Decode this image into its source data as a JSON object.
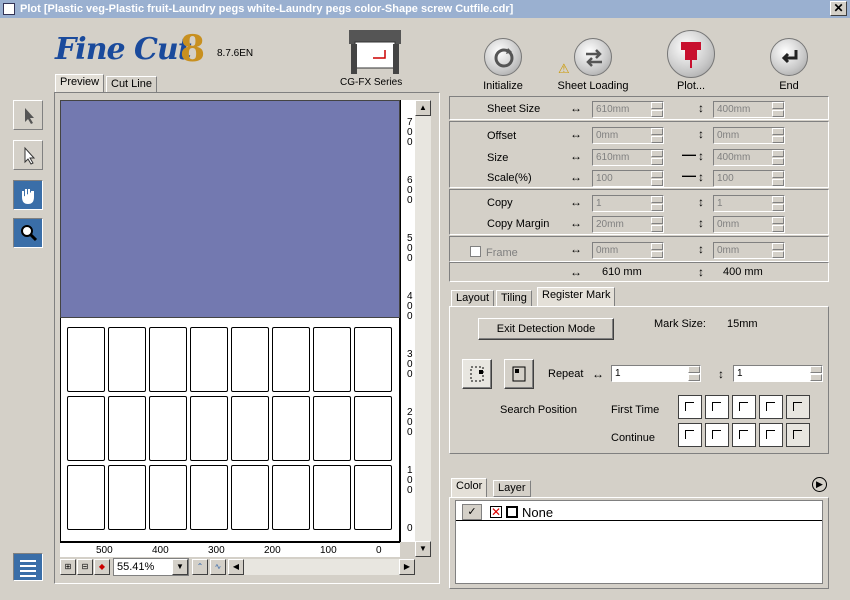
{
  "window": {
    "title": "Plot [Plastic veg-Plastic fruit-Laundry pegs white-Laundry pegs color-Shape screw Cutfile.cdr]",
    "close": "✕"
  },
  "logo": {
    "brand": "Fine Cut",
    "digit": "8",
    "version": "8.7.6EN",
    "series": "CG-FX Series"
  },
  "toolbar": {
    "initialize": "Initialize",
    "sheet_loading": "Sheet Loading",
    "plot": "Plot...",
    "end": "End"
  },
  "left_tabs": {
    "preview": "Preview",
    "cut_line": "Cut Line"
  },
  "ruler": {
    "h_labels": [
      "500",
      "400",
      "300",
      "200",
      "100",
      "0"
    ],
    "v_labels": [
      "7\n0\n0",
      "6\n0\n0",
      "5\n0\n0",
      "4\n0\n0",
      "3\n0\n0",
      "2\n0\n0",
      "1\n0\n0",
      "0"
    ]
  },
  "zoom": {
    "value": "55.41%"
  },
  "sheet": {
    "sheet_size_label": "Sheet Size",
    "sheet_w": "610mm",
    "sheet_h": "400mm",
    "offset_label": "Offset",
    "offset_x": "0mm",
    "offset_y": "0mm",
    "size_label": "Size",
    "size_w": "610mm",
    "size_h": "400mm",
    "scale_label": "Scale(%)",
    "scale_x": "100",
    "scale_y": "100",
    "copy_label": "Copy",
    "copy_x": "1",
    "copy_y": "1",
    "copy_margin_label": "Copy Margin",
    "margin_x": "20mm",
    "margin_y": "0mm",
    "frame_label": "Frame",
    "frame_x": "0mm",
    "frame_y": "0mm",
    "total_w": "610 mm",
    "total_h": "400 mm"
  },
  "mid_tabs": {
    "layout": "Layout",
    "tiling": "Tiling",
    "register_mark": "Register Mark"
  },
  "register": {
    "exit_btn": "Exit Detection Mode",
    "mark_size_label": "Mark Size:",
    "mark_size": "15mm",
    "repeat_label": "Repeat",
    "repeat_x": "1",
    "repeat_y": "1",
    "search_position": "Search Position",
    "first_time": "First Time",
    "continue": "Continue"
  },
  "bottom_tabs": {
    "color": "Color",
    "layer": "Layer"
  },
  "color_list": {
    "item": "None"
  }
}
